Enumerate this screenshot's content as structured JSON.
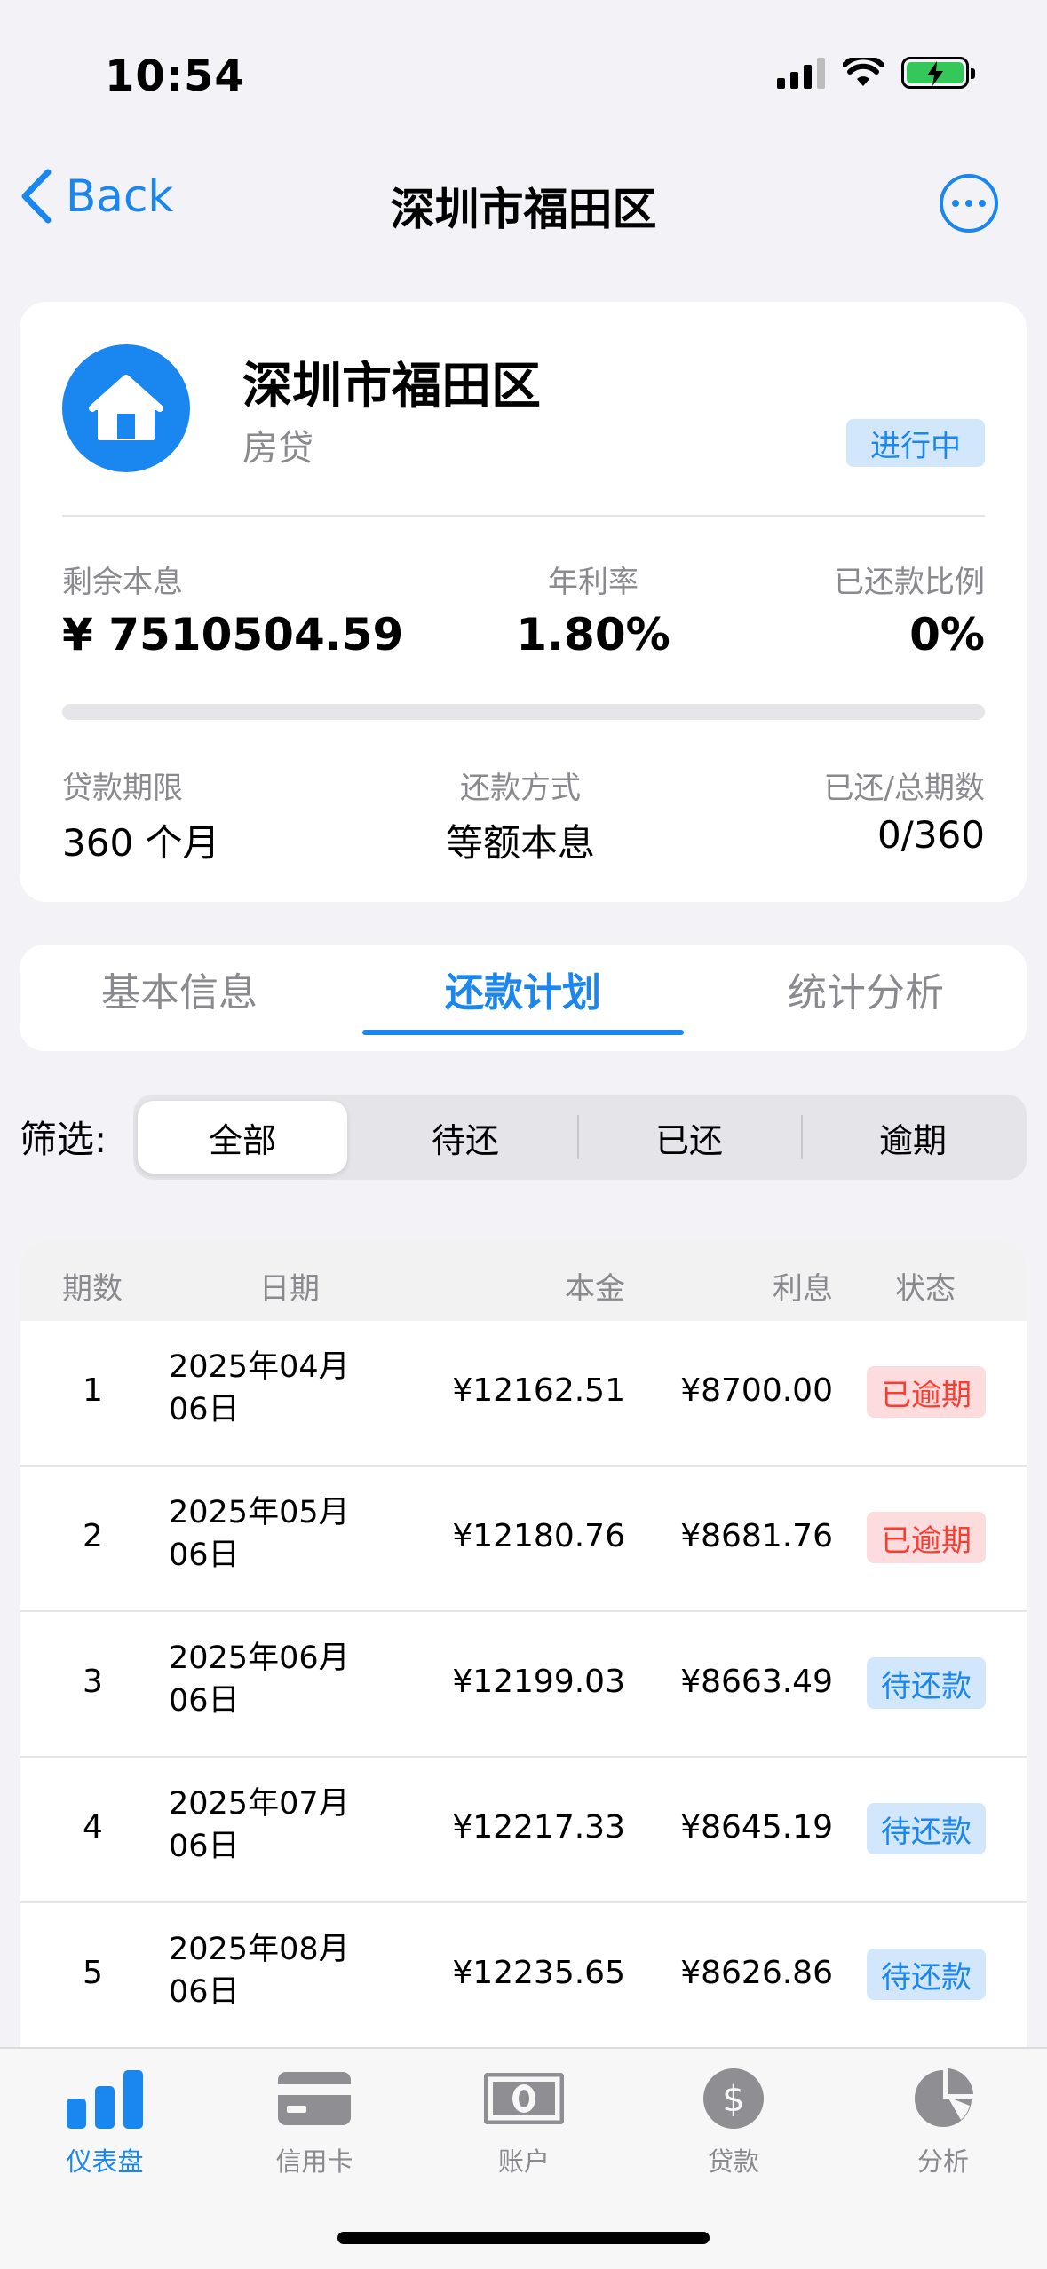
{
  "status_bar": {
    "time": "10:54"
  },
  "nav": {
    "back_label": "Back",
    "title": "深圳市福田区"
  },
  "loan": {
    "name": "深圳市福田区",
    "type": "房贷",
    "status_badge": "进行中",
    "remaining_label": "剩余本息",
    "remaining_value": "¥ 7510504.59",
    "rate_label": "年利率",
    "rate_value": "1.80%",
    "paid_ratio_label": "已还款比例",
    "paid_ratio_value": "0%",
    "paid_ratio_fraction": 0,
    "term_label": "贷款期限",
    "term_value": "360 个月",
    "method_label": "还款方式",
    "method_value": "等额本息",
    "periods_label": "已还/总期数",
    "periods_value": "0/360"
  },
  "tabs": [
    {
      "label": "基本信息",
      "active": false
    },
    {
      "label": "还款计划",
      "active": true
    },
    {
      "label": "统计分析",
      "active": false
    }
  ],
  "filter": {
    "label": "筛选:",
    "options": [
      {
        "label": "全部",
        "active": true
      },
      {
        "label": "待还",
        "active": false
      },
      {
        "label": "已还",
        "active": false
      },
      {
        "label": "逾期",
        "active": false
      }
    ]
  },
  "schedule": {
    "headers": {
      "period": "期数",
      "date": "日期",
      "principal": "本金",
      "interest": "利息",
      "status": "状态"
    },
    "rows": [
      {
        "period": "1",
        "date_line1": "2025年04月",
        "date_line2": "06日",
        "principal": "¥12162.51",
        "interest": "¥8700.00",
        "status": "已逾期",
        "status_type": "overdue"
      },
      {
        "period": "2",
        "date_line1": "2025年05月",
        "date_line2": "06日",
        "principal": "¥12180.76",
        "interest": "¥8681.76",
        "status": "已逾期",
        "status_type": "overdue"
      },
      {
        "period": "3",
        "date_line1": "2025年06月",
        "date_line2": "06日",
        "principal": "¥12199.03",
        "interest": "¥8663.49",
        "status": "待还款",
        "status_type": "pending"
      },
      {
        "period": "4",
        "date_line1": "2025年07月",
        "date_line2": "06日",
        "principal": "¥12217.33",
        "interest": "¥8645.19",
        "status": "待还款",
        "status_type": "pending"
      },
      {
        "period": "5",
        "date_line1": "2025年08月",
        "date_line2": "06日",
        "principal": "¥12235.65",
        "interest": "¥8626.86",
        "status": "待还款",
        "status_type": "pending"
      }
    ]
  },
  "tab_bar": [
    {
      "label": "仪表盘",
      "icon": "bar-chart-icon",
      "active": true
    },
    {
      "label": "信用卡",
      "icon": "credit-card-icon",
      "active": false
    },
    {
      "label": "账户",
      "icon": "banknote-icon",
      "active": false
    },
    {
      "label": "贷款",
      "icon": "dollar-circle-icon",
      "active": false
    },
    {
      "label": "分析",
      "icon": "pie-chart-icon",
      "active": false
    }
  ],
  "colors": {
    "accent": "#1a86f0",
    "overdue": "#ff3b30",
    "pending_bg": "#d2e7fb",
    "overdue_bg": "#fcdcdc"
  }
}
